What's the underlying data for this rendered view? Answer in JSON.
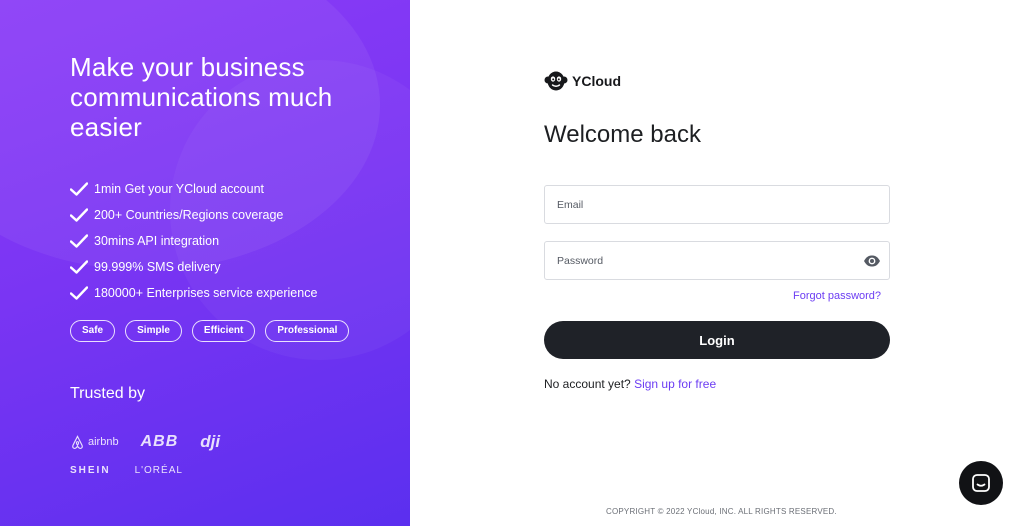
{
  "left_panel": {
    "headline": "Make your business communications much easier",
    "features": [
      "1min Get your YCloud account",
      "200+ Countries/Regions coverage",
      "30mins API integration",
      "99.999% SMS delivery",
      "180000+ Enterprises service experience"
    ],
    "pills": [
      "Safe",
      "Simple",
      "Efficient",
      "Professional"
    ],
    "trusted_label": "Trusted by",
    "logos": {
      "airbnb": "airbnb",
      "abb": "ABB",
      "dji": "dji",
      "shein": "SHEIN",
      "loreal": "L'ORÉAL"
    },
    "gradient_colors": [
      "#8b3cf7",
      "#5b2fef"
    ]
  },
  "brand": {
    "name": "YCloud",
    "logo_icon": "ycloud-monkey-logo"
  },
  "login": {
    "title": "Welcome back",
    "email_placeholder": "Email",
    "password_placeholder": "Password",
    "password_toggle_icon": "eye-icon",
    "forgot_password": "Forgot password?",
    "login_button": "Login",
    "no_account_text": "No account yet?",
    "signup_link": "Sign up for free"
  },
  "footer": {
    "copyright": "COPYRIGHT © 2022 YCloud, INC. ALL RIGHTS RESERVED."
  },
  "chat": {
    "icon": "chat-bubble-icon"
  },
  "colors": {
    "accent": "#6c3df3",
    "button": "#1f2228"
  }
}
